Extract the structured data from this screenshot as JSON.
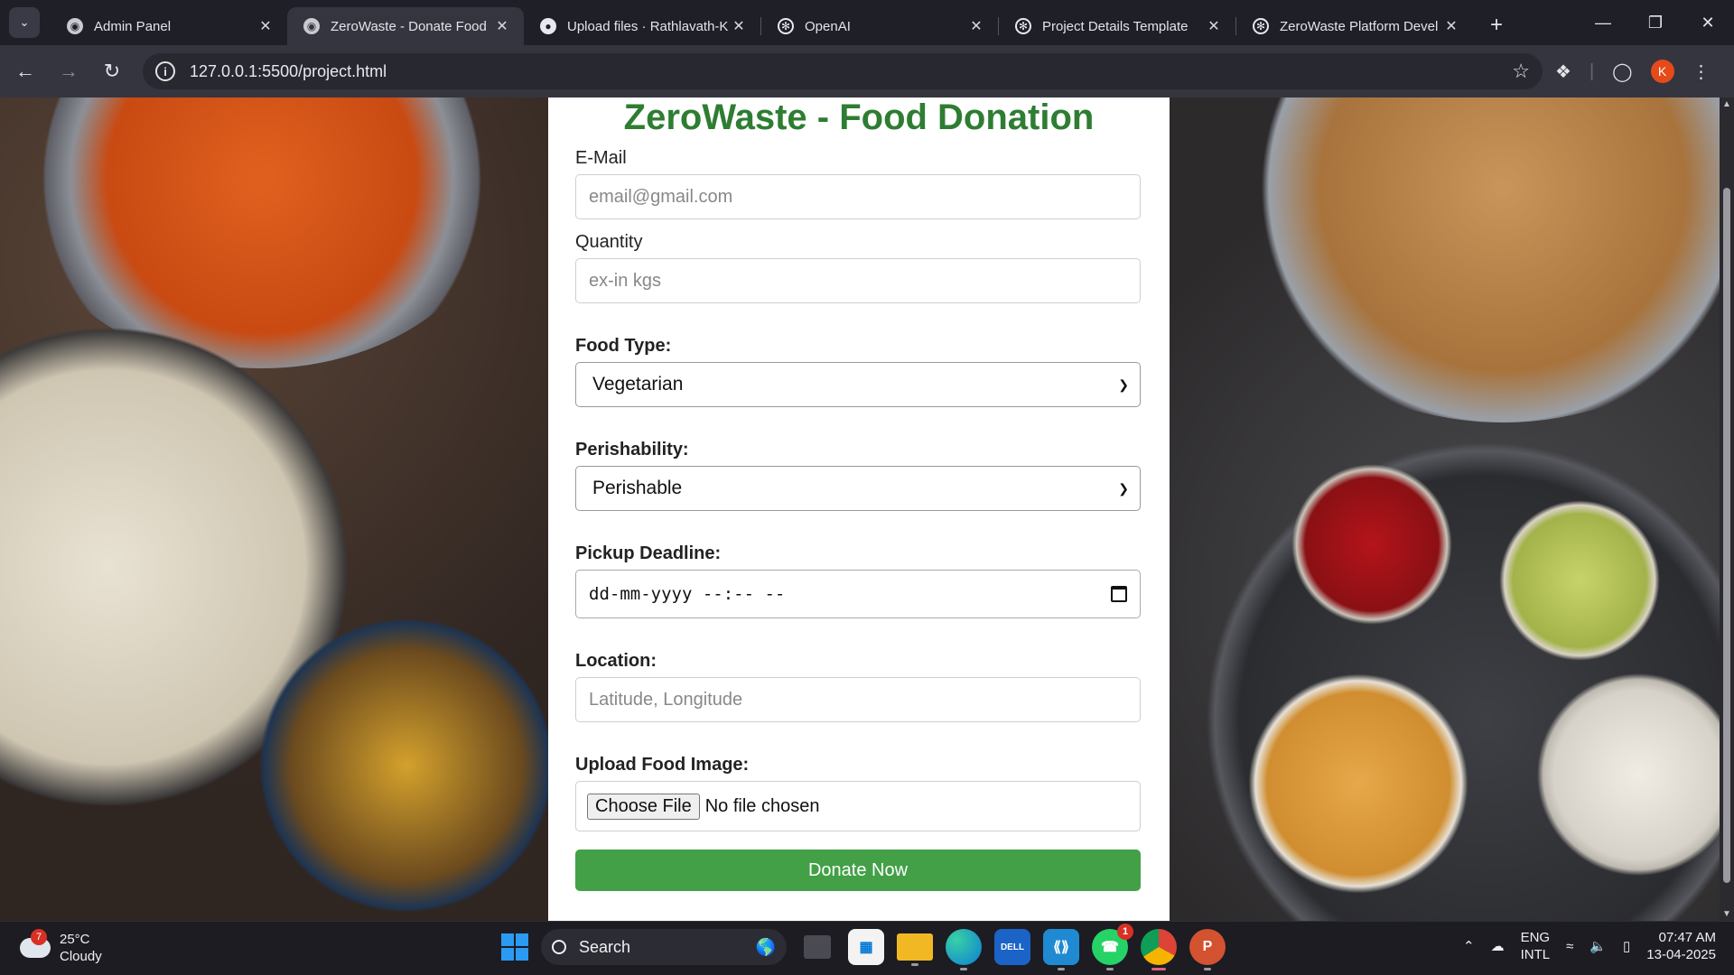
{
  "browser": {
    "tabs": [
      {
        "title": "Admin Panel",
        "favicon": "globe-icon",
        "active": false
      },
      {
        "title": "ZeroWaste - Donate Food",
        "favicon": "globe-icon",
        "active": true
      },
      {
        "title": "Upload files · Rathlavath-K",
        "favicon": "github-icon",
        "active": false
      },
      {
        "title": "OpenAI",
        "favicon": "openai-icon",
        "active": false
      },
      {
        "title": "Project Details Template",
        "favicon": "openai-icon",
        "active": false
      },
      {
        "title": "ZeroWaste Platform Devel",
        "favicon": "openai-icon",
        "active": false
      }
    ],
    "url": "127.0.0.1:5500/project.html",
    "profile_initial": "K"
  },
  "form": {
    "title": "ZeroWaste - Food Donation",
    "email_label": "E-Mail",
    "email_placeholder": "email@gmail.com",
    "quantity_label": "Quantity",
    "quantity_placeholder": "ex-in kgs",
    "food_type_label": "Food Type:",
    "food_type_value": "Vegetarian",
    "perishability_label": "Perishability:",
    "perishability_value": "Perishable",
    "deadline_label": "Pickup Deadline:",
    "deadline_value": "dd-mm-yyyy --:-- --",
    "location_label": "Location:",
    "location_placeholder": "Latitude, Longitude",
    "upload_label": "Upload Food Image:",
    "file_button": "Choose File",
    "file_status": "No file chosen",
    "submit_label": "Donate Now"
  },
  "taskbar": {
    "weather_temp": "25°C",
    "weather_desc": "Cloudy",
    "weather_badge": "7",
    "search_label": "Search",
    "whatsapp_badge": "1",
    "lang_top": "ENG",
    "lang_bottom": "INTL",
    "time": "07:47 AM",
    "date": "13-04-2025"
  },
  "colors": {
    "title_green": "#2e7d32",
    "button_green": "#43a047"
  }
}
